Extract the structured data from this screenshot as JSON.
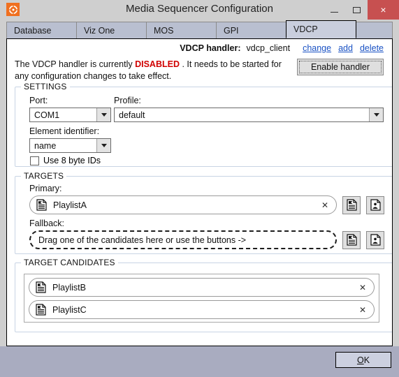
{
  "window": {
    "title": "Media Sequencer Configuration",
    "app_icon": "viz-target-icon",
    "minimize_label": "Minimize",
    "maximize_label": "Maximize",
    "close_label": "×"
  },
  "tabs": [
    {
      "label": "Database",
      "selected": false
    },
    {
      "label": "Viz One",
      "selected": false
    },
    {
      "label": "MOS",
      "selected": false
    },
    {
      "label": "GPI",
      "selected": false
    },
    {
      "label": "VDCP",
      "selected": true
    }
  ],
  "handler": {
    "label": "VDCP handler:",
    "name": "vdcp_client",
    "links": [
      "change",
      "add",
      "delete"
    ]
  },
  "status": {
    "prefix": "The VDCP handler is currently ",
    "state": "DISABLED",
    "suffix": " . It needs to be started for any configuration  changes to take effect.",
    "state_color": "#d00000",
    "button_label": "Enable handler"
  },
  "settings": {
    "legend": "SETTINGS",
    "port_label": "Port:",
    "port_value": "COM1",
    "profile_label": "Profile:",
    "profile_value": "default",
    "element_identifier_label": "Element identifier:",
    "element_identifier_value": "name",
    "use_8_byte_ids_label": "Use 8 byte IDs",
    "use_8_byte_ids_checked": false
  },
  "targets": {
    "legend": "TARGETS",
    "primary_label": "Primary:",
    "primary_value": "PlaylistA",
    "fallback_label": "Fallback:",
    "fallback_placeholder": "Drag one of the candidates here or use the buttons ->",
    "close_glyph": "✕",
    "button_icons": [
      "playlist-document-icon",
      "group-document-icon"
    ]
  },
  "candidates": {
    "legend": "TARGET CANDIDATES",
    "items": [
      {
        "label": "PlaylistB"
      },
      {
        "label": "PlaylistC"
      }
    ],
    "close_glyph": "✕"
  },
  "footer": {
    "ok_mnemonic": "O",
    "ok_rest": "K"
  },
  "colors": {
    "accent_link": "#1a52c4",
    "danger": "#d00000",
    "titlebar": "#cfcfcf",
    "close_button": "#c75050",
    "tab_selected": "#c9cedd",
    "tab_normal": "#b9bfd0",
    "footer": "#a9acc0",
    "app_icon": "#f07020"
  }
}
